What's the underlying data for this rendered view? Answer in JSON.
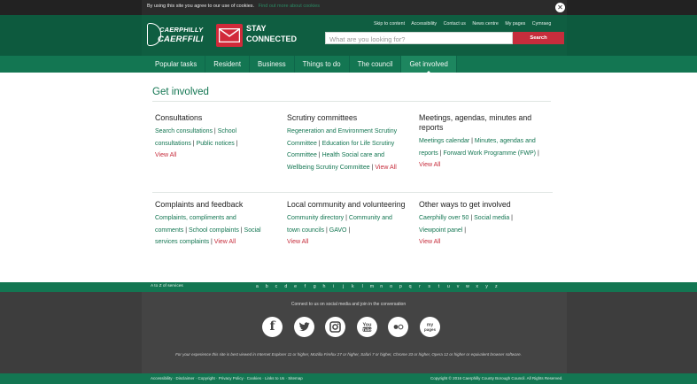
{
  "cookie": {
    "message": "By using this site you agree to our use of cookies.",
    "link": "Find out more about cookies",
    "close": "✕"
  },
  "header": {
    "logo_line1": "CAERPHILLY",
    "logo_line2": "CAERFFILI",
    "stay_line1": "STAY",
    "stay_line2": "CONNECTED",
    "top_links": [
      "Skip to content",
      "Accessibility",
      "Contact us",
      "News centre",
      "My pages",
      "Cymraeg"
    ],
    "search_placeholder": "What are you looking for?",
    "search_button": "Search"
  },
  "nav": {
    "items": [
      "Popular tasks",
      "Resident",
      "Business",
      "Things to do",
      "The council",
      "Get involved"
    ],
    "active_index": 5
  },
  "main": {
    "title": "Get involved",
    "sections": [
      {
        "heading": "Consultations",
        "links": [
          "Search consultations",
          "School consultations",
          "Public notices"
        ],
        "view_all": "View All"
      },
      {
        "heading": "Scrutiny committees",
        "links": [
          "Regeneration and Environment Scrutiny Committee",
          "Education for Life Scrutiny Committee",
          "Health Social care and Wellbeing Scrutiny Committee"
        ],
        "view_all": "View All"
      },
      {
        "heading": "Meetings, agendas, minutes and reports",
        "links": [
          "Meetings calendar",
          "Minutes, agendas and reports",
          "Forward Work Programme (FWP)"
        ],
        "view_all": "View All"
      },
      {
        "heading": "Complaints and feedback",
        "links": [
          "Complaints, compliments and comments",
          "School complaints",
          "Social services complaints"
        ],
        "view_all": "View All"
      },
      {
        "heading": "Local community and volunteering",
        "links": [
          "Community directory",
          "Community and town councils",
          "GAVO"
        ],
        "view_all": "View All"
      },
      {
        "heading": "Other ways to get involved",
        "links": [
          "Caerphilly over 50",
          "Social media",
          "Viewpoint panel"
        ],
        "view_all": "View All"
      }
    ]
  },
  "az": {
    "results": "A to Z of services",
    "letters": [
      "a",
      "b",
      "c",
      "d",
      "e",
      "f",
      "g",
      "h",
      "i",
      "j",
      "k",
      "l",
      "m",
      "n",
      "o",
      "p",
      "q",
      "r",
      "s",
      "t",
      "u",
      "v",
      "w",
      "x",
      "y",
      "z"
    ]
  },
  "footer": {
    "connect": "Connect to us on social media and join in the conversation",
    "social": [
      {
        "name": "facebook-icon",
        "glyph": "f"
      },
      {
        "name": "twitter-icon",
        "glyph": "t"
      },
      {
        "name": "instagram-icon",
        "glyph": "◎"
      },
      {
        "name": "youtube-icon",
        "glyph": "You"
      },
      {
        "name": "flickr-icon",
        "glyph": "●○"
      },
      {
        "name": "my-pages-icon",
        "glyph": "my pages"
      }
    ],
    "note": "For your experience this site is best viewed in Internet Explorer 11 or higher, Mozilla Firefox 27 or higher, Safari 7 or higher, Chrome 33 or higher, Opera 12 or higher or equivalent browser software.",
    "bottom_links": "Accessibility · Disclaimer · Copyright · Privacy Policy · Cookies · Links to Us · Sitemap",
    "copyright": "Copyright © 2016 Caerphilly County Borough Council. All Rights Reserved."
  },
  "colors": {
    "brand_green": "#137652",
    "dark_green": "#0f5e41",
    "accent_red": "#c62d3c",
    "footer_grey": "#444444"
  }
}
